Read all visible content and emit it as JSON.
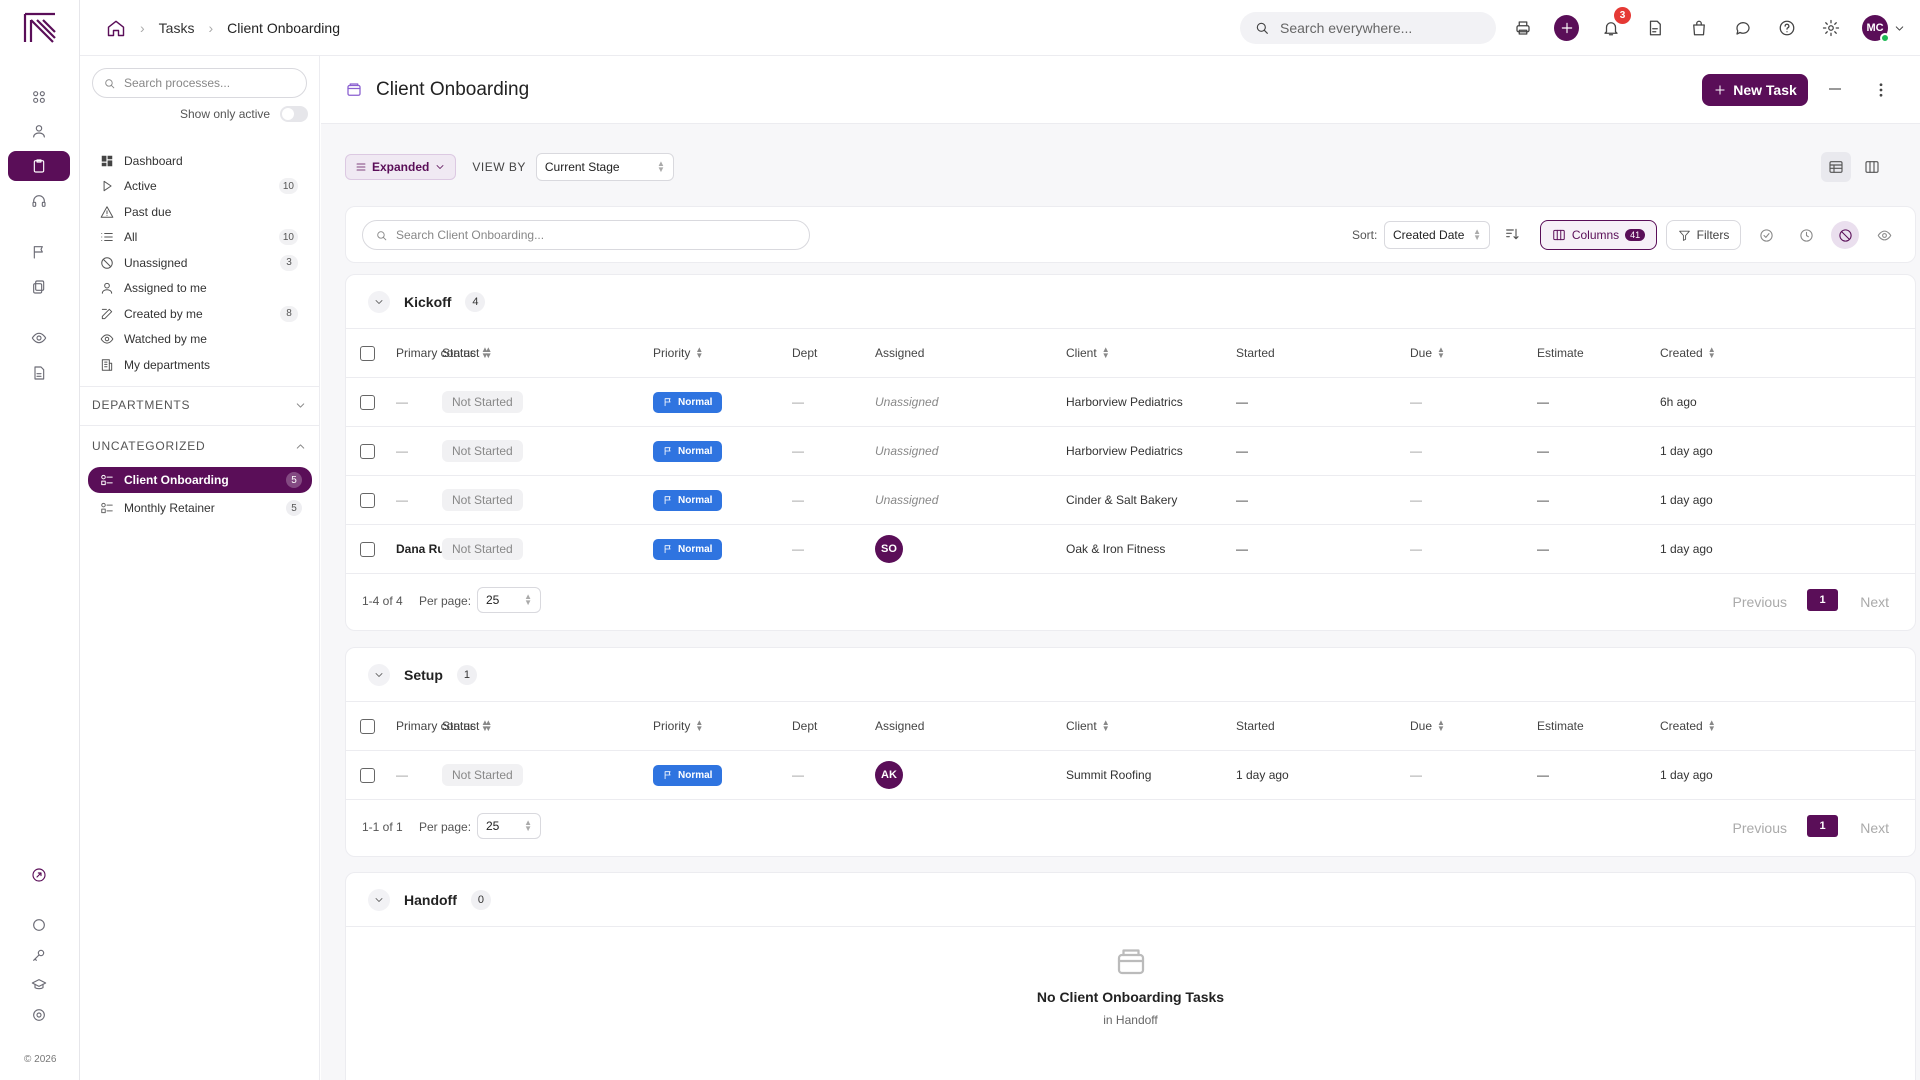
{
  "app": {
    "copyright": "© 2026"
  },
  "colors": {
    "brand": "#5a0e58",
    "priority_normal": "#2f74e0",
    "notification": "#e53935",
    "online": "#1db954"
  },
  "breadcrumb": {
    "items": [
      "Tasks",
      "Client Onboarding"
    ]
  },
  "global_search": {
    "placeholder": "Search everywhere..."
  },
  "header": {
    "notification_count": "3",
    "user_initials": "MC"
  },
  "sidebar": {
    "search_placeholder": "Search processes...",
    "show_only_active": "Show only active",
    "nav": [
      {
        "label": "Dashboard",
        "icon": "dashboard-icon",
        "count": ""
      },
      {
        "label": "Active",
        "icon": "play-icon",
        "count": "10"
      },
      {
        "label": "Past due",
        "icon": "warning-icon",
        "count": ""
      },
      {
        "label": "All",
        "icon": "list-icon",
        "count": "10"
      },
      {
        "label": "Unassigned",
        "icon": "block-icon",
        "count": "3"
      },
      {
        "label": "Assigned to me",
        "icon": "user-icon",
        "count": ""
      },
      {
        "label": "Created by me",
        "icon": "edit-icon",
        "count": "8"
      },
      {
        "label": "Watched by me",
        "icon": "eye-icon",
        "count": ""
      },
      {
        "label": "My departments",
        "icon": "building-icon",
        "count": ""
      }
    ],
    "departments_label": "DEPARTMENTS",
    "uncategorized_label": "UNCATEGORIZED",
    "processes": [
      {
        "label": "Client Onboarding",
        "count": "5",
        "active": true
      },
      {
        "label": "Monthly Retainer",
        "count": "5",
        "active": false
      }
    ]
  },
  "page": {
    "title": "Client Onboarding",
    "new_task_label": "New Task",
    "expanded_label": "Expanded",
    "view_by_label": "VIEW BY",
    "view_by_value": "Current Stage",
    "search_placeholder": "Search Client Onboarding...",
    "sort_label": "Sort:",
    "sort_value": "Created Date",
    "columns_label": "Columns",
    "columns_count": "41",
    "filters_label": "Filters"
  },
  "table_columns": [
    "Primary contact",
    "Status",
    "Priority",
    "Dept",
    "Assigned",
    "Client",
    "Started",
    "Due",
    "Estimate",
    "Created"
  ],
  "groups": [
    {
      "name": "Kickoff",
      "count": "4",
      "rows": [
        {
          "contact": "—",
          "status": "Not Started",
          "priority": "Normal",
          "dept": "—",
          "assigned": "Unassigned",
          "assigned_avatar": "",
          "client": "Harborview Pediatrics",
          "started": "—",
          "due": "—",
          "estimate": "—",
          "created": "6h ago"
        },
        {
          "contact": "—",
          "status": "Not Started",
          "priority": "Normal",
          "dept": "—",
          "assigned": "Unassigned",
          "assigned_avatar": "",
          "client": "Harborview Pediatrics",
          "started": "—",
          "due": "—",
          "estimate": "—",
          "created": "1 day ago"
        },
        {
          "contact": "—",
          "status": "Not Started",
          "priority": "Normal",
          "dept": "—",
          "assigned": "Unassigned",
          "assigned_avatar": "",
          "client": "Cinder & Salt Bakery",
          "started": "—",
          "due": "—",
          "estimate": "—",
          "created": "1 day ago"
        },
        {
          "contact": "Dana Ruiz",
          "status": "Not Started",
          "priority": "Normal",
          "dept": "—",
          "assigned": "",
          "assigned_avatar": "SO",
          "client": "Oak & Iron Fitness",
          "started": "—",
          "due": "—",
          "estimate": "—",
          "created": "1 day ago"
        }
      ],
      "pager": {
        "range": "1-4 of 4",
        "per_page_label": "Per page:",
        "per_page": "25",
        "prev": "Previous",
        "page": "1",
        "next": "Next"
      }
    },
    {
      "name": "Setup",
      "count": "1",
      "rows": [
        {
          "contact": "—",
          "status": "Not Started",
          "priority": "Normal",
          "dept": "—",
          "assigned": "",
          "assigned_avatar": "AK",
          "client": "Summit Roofing",
          "started": "1 day ago",
          "due": "—",
          "estimate": "—",
          "created": "1 day ago"
        }
      ],
      "pager": {
        "range": "1-1 of 1",
        "per_page_label": "Per page:",
        "per_page": "25",
        "prev": "Previous",
        "page": "1",
        "next": "Next"
      }
    },
    {
      "name": "Handoff",
      "count": "0",
      "rows": [],
      "empty_title": "No Client Onboarding Tasks",
      "empty_sub": "in Handoff"
    }
  ]
}
